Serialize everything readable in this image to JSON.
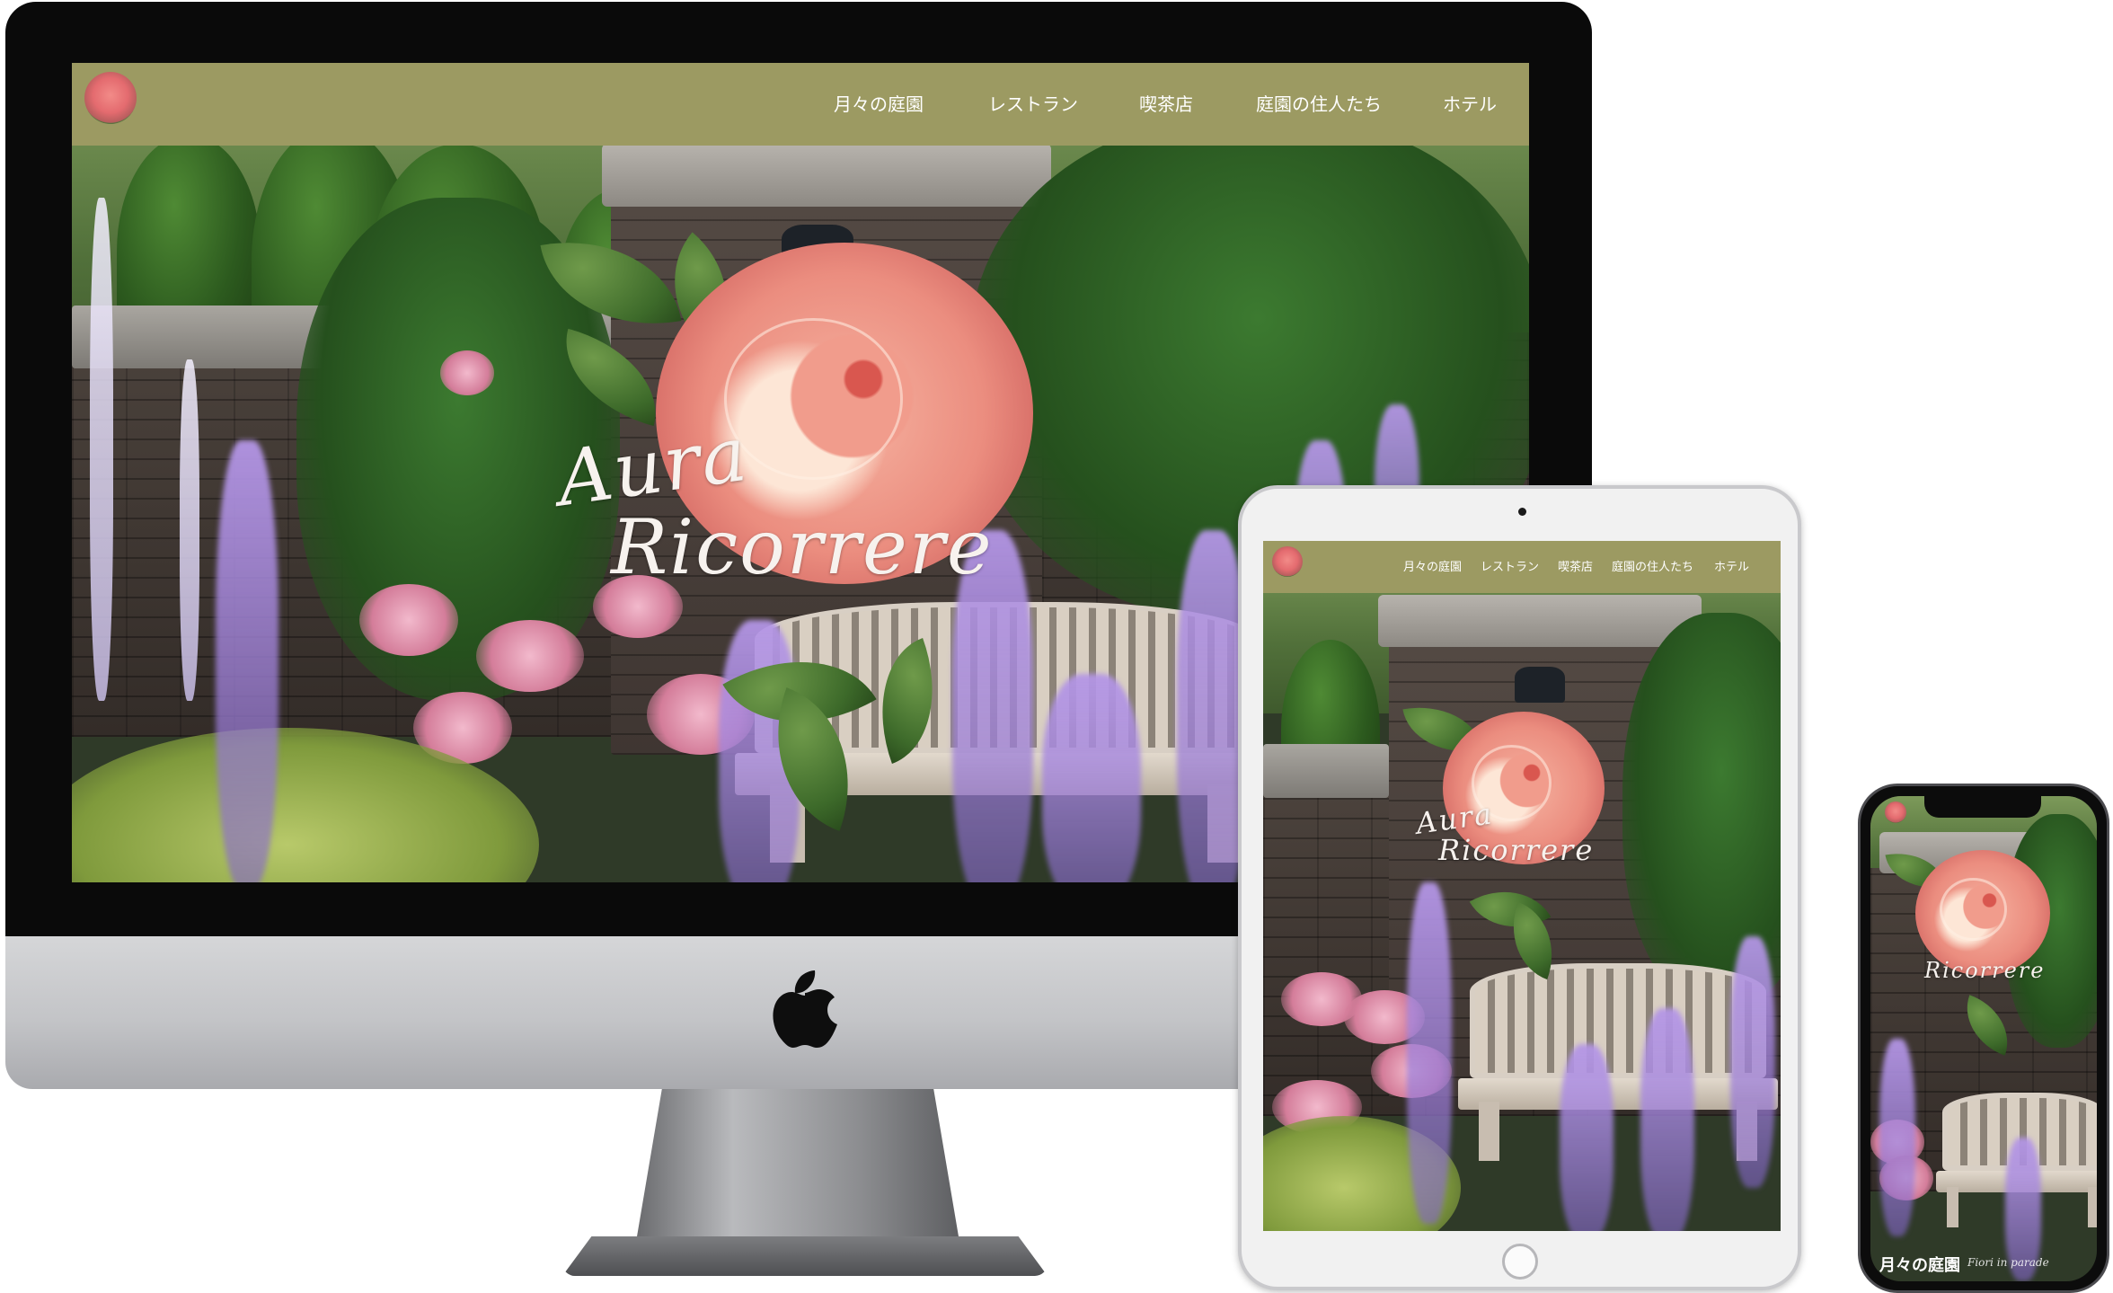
{
  "site": {
    "nav_items": [
      "月々の庭園",
      "レストラン",
      "喫茶店",
      "庭園の住人たち",
      "ホテル"
    ],
    "hero_script_line1": "Aura",
    "hero_script_line2": "Ricorrere",
    "phone_caption": "月々の庭園",
    "phone_caption_script": "Fiori in parade",
    "nav_color": "#9c9a62"
  },
  "icons": {
    "site_logo": "rose-logo-icon",
    "device_brand": "apple-logo-icon"
  }
}
